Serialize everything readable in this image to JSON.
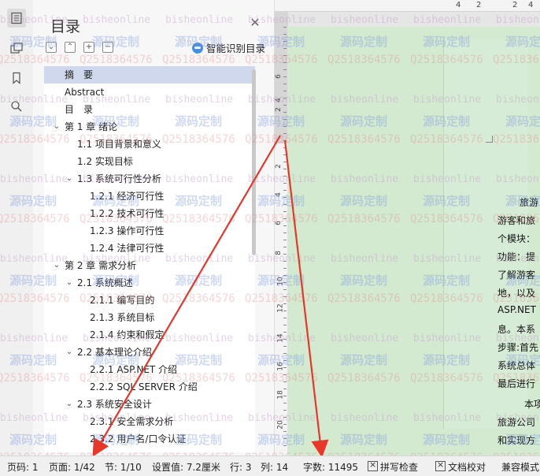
{
  "rail": {
    "icons": [
      "toc-icon",
      "folders-icon",
      "bookmark-icon",
      "search-icon"
    ]
  },
  "panel": {
    "title": "目录",
    "smart_label": "智能识别目录",
    "toc": [
      {
        "text": "摘　要",
        "level": 0,
        "expandable": false,
        "selected": true
      },
      {
        "text": "Abstract",
        "level": 0,
        "expandable": false
      },
      {
        "text": "目　录",
        "level": 0,
        "expandable": false
      },
      {
        "text": "第 1 章  绪论",
        "level": 0,
        "expandable": true
      },
      {
        "text": "1.1 项目背景和意义",
        "level": 1,
        "expandable": false
      },
      {
        "text": "1.2 实现目标",
        "level": 1,
        "expandable": false
      },
      {
        "text": "1.3  系统可行性分析",
        "level": 1,
        "expandable": true
      },
      {
        "text": "1.2.1  经济可行性",
        "level": 2,
        "expandable": false
      },
      {
        "text": "1.2.2  技术可行性",
        "level": 2,
        "expandable": false
      },
      {
        "text": "1.2.3  操作可行性",
        "level": 2,
        "expandable": false
      },
      {
        "text": "1.2.4  法律可行性",
        "level": 2,
        "expandable": false
      },
      {
        "text": "第 2 章  需求分析",
        "level": 0,
        "expandable": true
      },
      {
        "text": "2.1 系统概述",
        "level": 1,
        "expandable": true
      },
      {
        "text": "2.1.1 编写目的",
        "level": 2,
        "expandable": false
      },
      {
        "text": "2.1.3 系统目标",
        "level": 2,
        "expandable": false
      },
      {
        "text": "2.1.4 约束和假定",
        "level": 2,
        "expandable": false
      },
      {
        "text": "2.2 基本理论介绍",
        "level": 1,
        "expandable": true
      },
      {
        "text": "2.2.1 ASP.NET 介绍",
        "level": 2,
        "expandable": false
      },
      {
        "text": "2.2.2 SQL SERVER 介绍",
        "level": 2,
        "expandable": false
      },
      {
        "text": "2.3 系统安全设计",
        "level": 1,
        "expandable": true
      },
      {
        "text": "2.3.1 安全需求分析",
        "level": 2,
        "expandable": false
      },
      {
        "text": "2.3.2 用户名/口令认证",
        "level": 2,
        "expandable": false
      }
    ]
  },
  "document": {
    "hruler_numbers": [
      "4",
      "2",
      "2",
      "4"
    ],
    "vruler_numbers": [
      "6",
      "4",
      "2",
      "2",
      "4",
      "6",
      "8",
      "10",
      "12",
      "14",
      "16",
      "18",
      "20"
    ],
    "lines": [
      "旅游",
      "游客和旅",
      "个模块：",
      "功能：提",
      "了解游客",
      "地，以及",
      "ASP.NET",
      "息。本系",
      "步骤:首先",
      "系统总体",
      "最后进行",
      "本项",
      "旅游公司",
      "和实现方"
    ]
  },
  "watermark": {
    "site": "bisheonline",
    "slogan": "源码定制",
    "qq": "Q2518364576"
  },
  "status": {
    "page_code": "页码: 1",
    "page": "页面: 1/42",
    "section": "节: 1/10",
    "setting": "设置值: 7.2厘米",
    "row": "行: 3",
    "col": "列: 14",
    "words": "字数: 11495",
    "spell": "拼写检查",
    "proof": "文档校对",
    "compat": "兼容模式"
  },
  "colors": {
    "selection": "#cfd8ec",
    "page_bg": "#d3ead1",
    "arrow": "#e8362b"
  }
}
